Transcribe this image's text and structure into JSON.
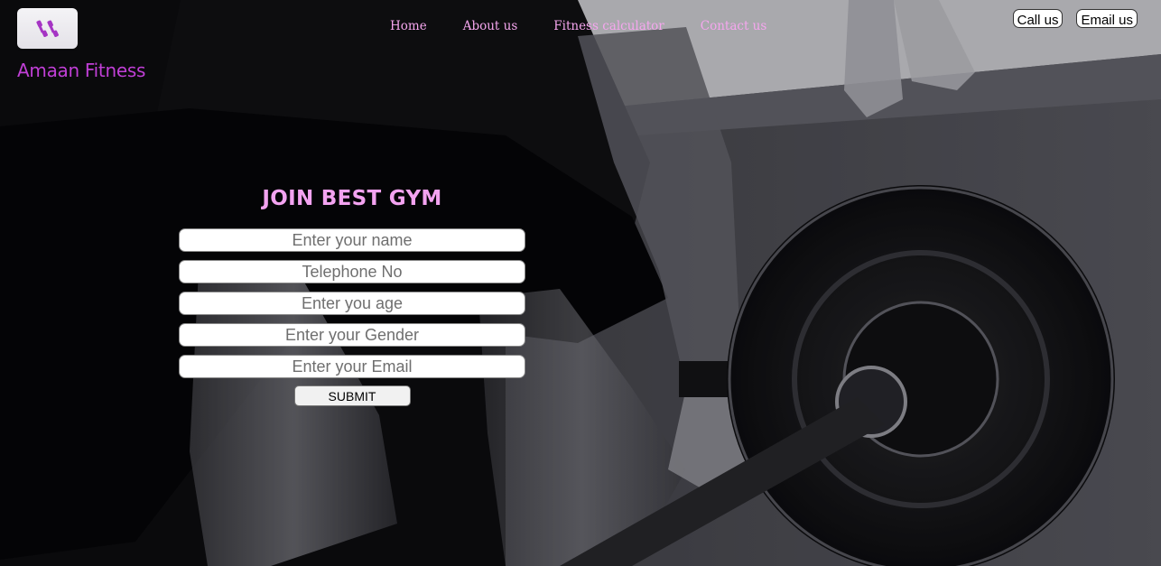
{
  "brand": {
    "logo_icon": "dumbbell-icon",
    "name": "Amaan Fitness"
  },
  "nav": {
    "items": [
      {
        "label": "Home"
      },
      {
        "label": "About us"
      },
      {
        "label": "Fitness calculator"
      },
      {
        "label": "Contact us"
      }
    ]
  },
  "contact": {
    "call_label": "Call us",
    "email_label": "Email us"
  },
  "form": {
    "title": "JOIN BEST GYM",
    "fields": [
      {
        "placeholder": "Enter your name",
        "value": ""
      },
      {
        "placeholder": "Telephone No",
        "value": ""
      },
      {
        "placeholder": "Enter you age",
        "value": ""
      },
      {
        "placeholder": "Enter your Gender",
        "value": ""
      },
      {
        "placeholder": "Enter your Email",
        "value": ""
      }
    ],
    "submit_label": "SUBMIT"
  },
  "colors": {
    "brand": "#c03fd6",
    "nav_link": "#f5a6ee",
    "form_title": "#f3a3f0"
  }
}
